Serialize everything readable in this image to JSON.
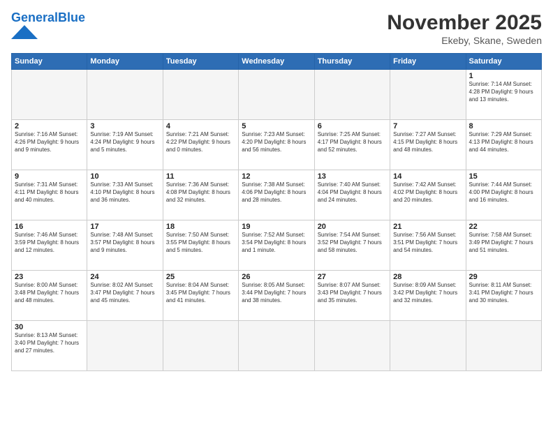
{
  "header": {
    "logo_general": "General",
    "logo_blue": "Blue",
    "title": "November 2025",
    "subtitle": "Ekeby, Skane, Sweden"
  },
  "days_of_week": [
    "Sunday",
    "Monday",
    "Tuesday",
    "Wednesday",
    "Thursday",
    "Friday",
    "Saturday"
  ],
  "weeks": [
    [
      {
        "day": "",
        "info": ""
      },
      {
        "day": "",
        "info": ""
      },
      {
        "day": "",
        "info": ""
      },
      {
        "day": "",
        "info": ""
      },
      {
        "day": "",
        "info": ""
      },
      {
        "day": "",
        "info": ""
      },
      {
        "day": "1",
        "info": "Sunrise: 7:14 AM\nSunset: 4:28 PM\nDaylight: 9 hours\nand 13 minutes."
      }
    ],
    [
      {
        "day": "2",
        "info": "Sunrise: 7:16 AM\nSunset: 4:26 PM\nDaylight: 9 hours\nand 9 minutes."
      },
      {
        "day": "3",
        "info": "Sunrise: 7:19 AM\nSunset: 4:24 PM\nDaylight: 9 hours\nand 5 minutes."
      },
      {
        "day": "4",
        "info": "Sunrise: 7:21 AM\nSunset: 4:22 PM\nDaylight: 9 hours\nand 0 minutes."
      },
      {
        "day": "5",
        "info": "Sunrise: 7:23 AM\nSunset: 4:20 PM\nDaylight: 8 hours\nand 56 minutes."
      },
      {
        "day": "6",
        "info": "Sunrise: 7:25 AM\nSunset: 4:17 PM\nDaylight: 8 hours\nand 52 minutes."
      },
      {
        "day": "7",
        "info": "Sunrise: 7:27 AM\nSunset: 4:15 PM\nDaylight: 8 hours\nand 48 minutes."
      },
      {
        "day": "8",
        "info": "Sunrise: 7:29 AM\nSunset: 4:13 PM\nDaylight: 8 hours\nand 44 minutes."
      }
    ],
    [
      {
        "day": "9",
        "info": "Sunrise: 7:31 AM\nSunset: 4:11 PM\nDaylight: 8 hours\nand 40 minutes."
      },
      {
        "day": "10",
        "info": "Sunrise: 7:33 AM\nSunset: 4:10 PM\nDaylight: 8 hours\nand 36 minutes."
      },
      {
        "day": "11",
        "info": "Sunrise: 7:36 AM\nSunset: 4:08 PM\nDaylight: 8 hours\nand 32 minutes."
      },
      {
        "day": "12",
        "info": "Sunrise: 7:38 AM\nSunset: 4:06 PM\nDaylight: 8 hours\nand 28 minutes."
      },
      {
        "day": "13",
        "info": "Sunrise: 7:40 AM\nSunset: 4:04 PM\nDaylight: 8 hours\nand 24 minutes."
      },
      {
        "day": "14",
        "info": "Sunrise: 7:42 AM\nSunset: 4:02 PM\nDaylight: 8 hours\nand 20 minutes."
      },
      {
        "day": "15",
        "info": "Sunrise: 7:44 AM\nSunset: 4:00 PM\nDaylight: 8 hours\nand 16 minutes."
      }
    ],
    [
      {
        "day": "16",
        "info": "Sunrise: 7:46 AM\nSunset: 3:59 PM\nDaylight: 8 hours\nand 12 minutes."
      },
      {
        "day": "17",
        "info": "Sunrise: 7:48 AM\nSunset: 3:57 PM\nDaylight: 8 hours\nand 9 minutes."
      },
      {
        "day": "18",
        "info": "Sunrise: 7:50 AM\nSunset: 3:55 PM\nDaylight: 8 hours\nand 5 minutes."
      },
      {
        "day": "19",
        "info": "Sunrise: 7:52 AM\nSunset: 3:54 PM\nDaylight: 8 hours\nand 1 minute."
      },
      {
        "day": "20",
        "info": "Sunrise: 7:54 AM\nSunset: 3:52 PM\nDaylight: 7 hours\nand 58 minutes."
      },
      {
        "day": "21",
        "info": "Sunrise: 7:56 AM\nSunset: 3:51 PM\nDaylight: 7 hours\nand 54 minutes."
      },
      {
        "day": "22",
        "info": "Sunrise: 7:58 AM\nSunset: 3:49 PM\nDaylight: 7 hours\nand 51 minutes."
      }
    ],
    [
      {
        "day": "23",
        "info": "Sunrise: 8:00 AM\nSunset: 3:48 PM\nDaylight: 7 hours\nand 48 minutes."
      },
      {
        "day": "24",
        "info": "Sunrise: 8:02 AM\nSunset: 3:47 PM\nDaylight: 7 hours\nand 45 minutes."
      },
      {
        "day": "25",
        "info": "Sunrise: 8:04 AM\nSunset: 3:45 PM\nDaylight: 7 hours\nand 41 minutes."
      },
      {
        "day": "26",
        "info": "Sunrise: 8:05 AM\nSunset: 3:44 PM\nDaylight: 7 hours\nand 38 minutes."
      },
      {
        "day": "27",
        "info": "Sunrise: 8:07 AM\nSunset: 3:43 PM\nDaylight: 7 hours\nand 35 minutes."
      },
      {
        "day": "28",
        "info": "Sunrise: 8:09 AM\nSunset: 3:42 PM\nDaylight: 7 hours\nand 32 minutes."
      },
      {
        "day": "29",
        "info": "Sunrise: 8:11 AM\nSunset: 3:41 PM\nDaylight: 7 hours\nand 30 minutes."
      }
    ],
    [
      {
        "day": "30",
        "info": "Sunrise: 8:13 AM\nSunset: 3:40 PM\nDaylight: 7 hours\nand 27 minutes."
      },
      {
        "day": "",
        "info": ""
      },
      {
        "day": "",
        "info": ""
      },
      {
        "day": "",
        "info": ""
      },
      {
        "day": "",
        "info": ""
      },
      {
        "day": "",
        "info": ""
      },
      {
        "day": "",
        "info": ""
      }
    ]
  ]
}
